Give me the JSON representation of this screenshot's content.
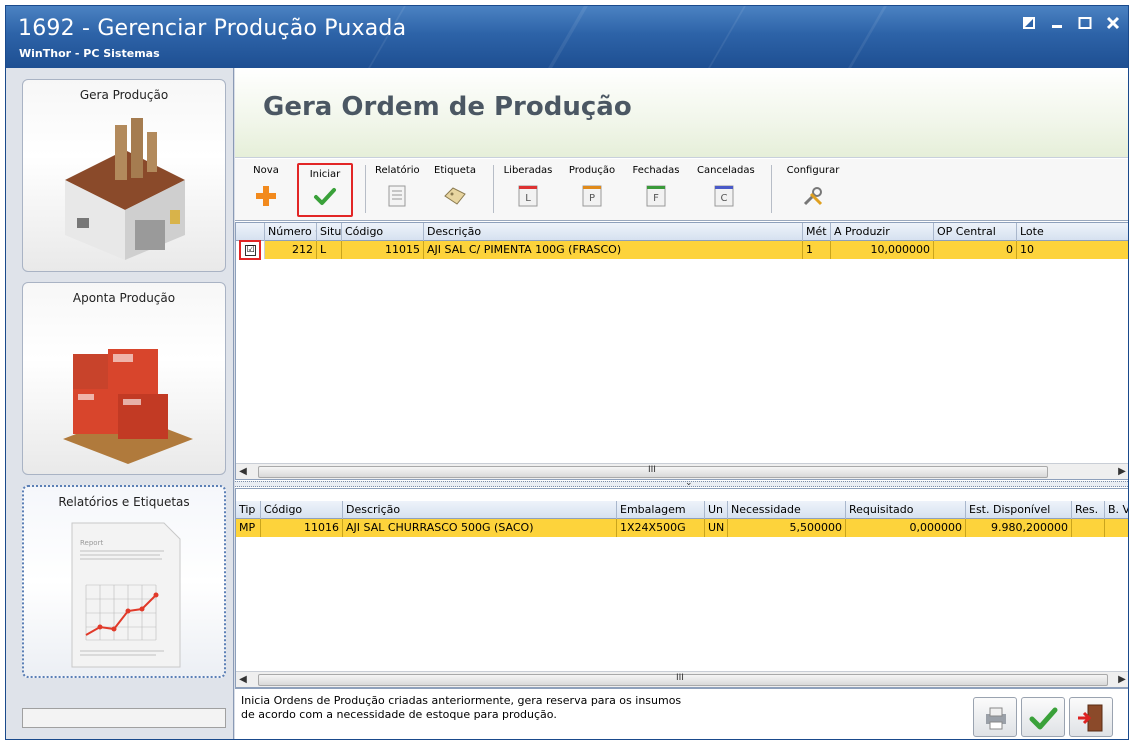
{
  "window": {
    "title": "1692 - Gerenciar Produção Puxada",
    "subtitle": "WinThor - PC Sistemas"
  },
  "nav": {
    "items": [
      {
        "label": "Gera Produção",
        "icon": "factory-icon"
      },
      {
        "label": "Aponta Produção",
        "icon": "boxes-pallet-icon"
      },
      {
        "label": "Relatórios e Etiquetas",
        "icon": "report-chart-icon",
        "doc_title": "Report"
      }
    ]
  },
  "main": {
    "title": "Gera Ordem de Produção"
  },
  "toolbar": {
    "nova": "Nova",
    "iniciar": "Iniciar",
    "relatorio": "Relatório",
    "etiqueta": "Etiqueta",
    "liberadas": "Liberadas",
    "producao": "Produção",
    "fechadas": "Fechadas",
    "canceladas": "Canceladas",
    "configurar": "Configurar",
    "liberadas_letter": "L",
    "producao_letter": "P",
    "fechadas_letter": "F",
    "canceladas_letter": "C"
  },
  "orders_grid": {
    "headers": {
      "numero_op": "Número OP",
      "situ": "Situ.",
      "codigo": "Código",
      "descricao": "Descrição",
      "met": "Mét",
      "a_produzir": "A Produzir",
      "op_central": "OP Central",
      "lote": "Lote"
    },
    "rows": [
      {
        "checked": "☑",
        "numero_op": "212",
        "situ": "L",
        "codigo": "11015",
        "descricao": "AJI SAL C/ PIMENTA 100G (FRASCO)",
        "met": "1",
        "a_produzir": "10,000000",
        "op_central": "0",
        "lote": "10"
      }
    ]
  },
  "inputs_grid": {
    "headers": {
      "tip": "Tip",
      "codigo": "Código",
      "descricao": "Descrição",
      "embalagem": "Embalagem",
      "un": "Un",
      "necessidade": "Necessidade",
      "requisitado": "Requisitado",
      "est_disponivel": "Est. Disponível",
      "res": "Res.",
      "b_vi": "B. Vi"
    },
    "rows": [
      {
        "tip": "MP",
        "codigo": "11016",
        "descricao": "AJI SAL CHURRASCO 500G (SACO)",
        "embalagem": "1X24X500G",
        "un": "UN",
        "necessidade": "5,500000",
        "requisitado": "0,000000",
        "est_disponivel": "9.980,200000"
      }
    ]
  },
  "scroll": {
    "grip": "III"
  },
  "hint": {
    "line1": "Inicia Ordens de Produção criadas anteriormente, gera reserva para os insumos",
    "line2": "de acordo com a necessidade de estoque para produção."
  },
  "colors": {
    "row_highlight": "#fdd33b",
    "titlebar": "#2d63a8",
    "highlight_border": "#e22626"
  }
}
